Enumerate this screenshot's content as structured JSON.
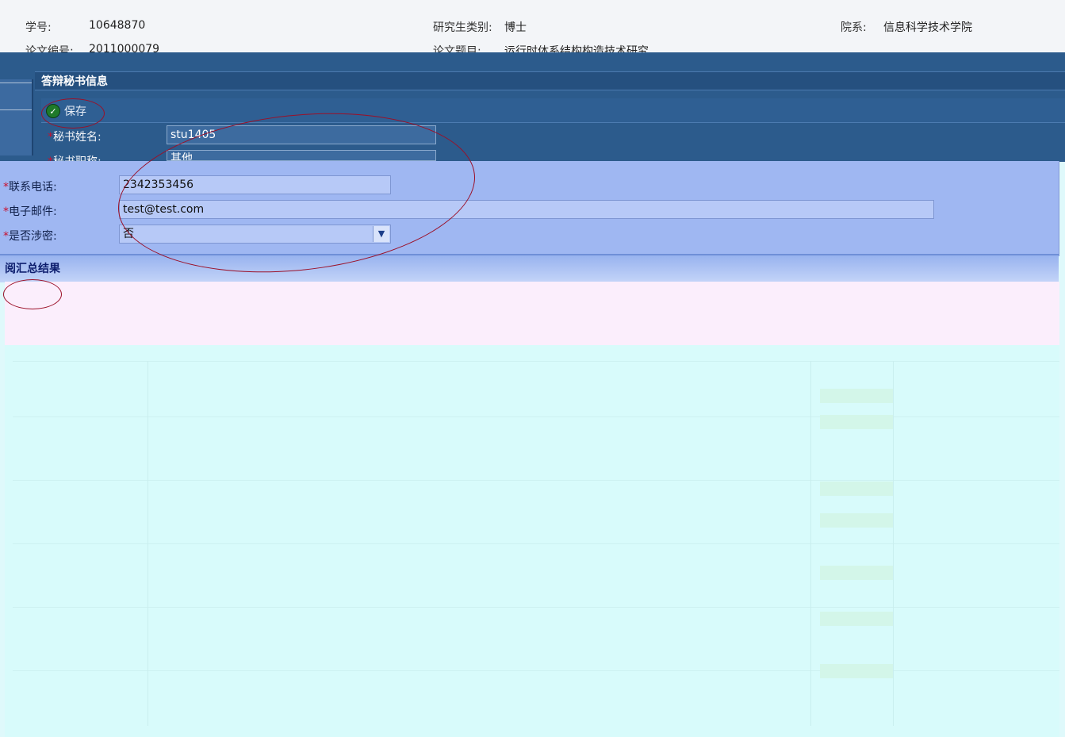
{
  "header": {
    "student_id_label": "学号:",
    "student_id": "10648870",
    "thesis_no_label": "论文编号:",
    "thesis_no": "2011000079",
    "grad_type_label": "研究生类别:",
    "grad_type": "博士",
    "thesis_title_label": "论文题目:",
    "thesis_title": "运行时体系结构构造技术研究",
    "dept_label": "院系:",
    "dept": "信息科学技术学院"
  },
  "secretary": {
    "section_title": "答辩秘书信息",
    "save_label": "保存",
    "name_label": "秘书姓名:",
    "name_value": "stu1405",
    "title_label": "秘书职称:",
    "title_value": "其他",
    "phone_label": "联系电话:",
    "phone_value": "2342353456",
    "email_label": "电子邮件:",
    "email_value": "test@test.com",
    "secret_label": "是否涉密:",
    "secret_value": "否",
    "required_mark": "*"
  },
  "summary": {
    "section_title": "阅汇总结果"
  },
  "colors": {
    "dark_panel": "#2c5b8c",
    "light_panel": "#9fb7f2",
    "annotation": "#9b1028",
    "required": "#c8102e"
  }
}
